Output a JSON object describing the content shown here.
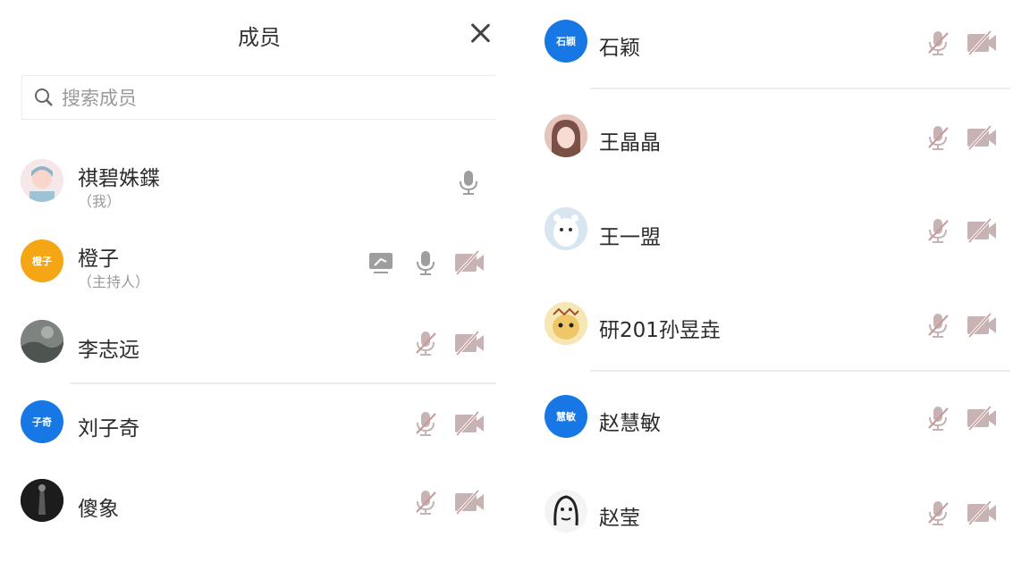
{
  "left_panel": {
    "title": "成员",
    "search_placeholder": "搜索成员",
    "members": [
      {
        "name": "祺碧姝鍱",
        "role": "（我）",
        "avatar_kind": "photo",
        "avatar_color": "#f3d9dc"
      },
      {
        "name": "橙子",
        "role": "（主持人）",
        "avatar_kind": "text",
        "avatar_text": "橙子",
        "avatar_color": "#f5a614"
      },
      {
        "name": "李志远",
        "role": "",
        "avatar_kind": "photo",
        "avatar_color": "#6e7570"
      },
      {
        "name": "刘子奇",
        "role": "",
        "avatar_kind": "text",
        "avatar_text": "子奇",
        "avatar_color": "#1677e5"
      },
      {
        "name": "傻象",
        "role": "",
        "avatar_kind": "photo",
        "avatar_color": "#1c1c1c"
      }
    ]
  },
  "right_panel": {
    "members": [
      {
        "name": "石颖",
        "avatar_kind": "text",
        "avatar_text": "石颖",
        "avatar_color": "#1677e5"
      },
      {
        "name": "王晶晶",
        "avatar_kind": "photo",
        "avatar_color": "#d9b0a6"
      },
      {
        "name": "王一盟",
        "avatar_kind": "photo",
        "avatar_color": "#c9dceb"
      },
      {
        "name": "研201孙昱垚",
        "avatar_kind": "photo",
        "avatar_color": "#f0c766"
      },
      {
        "name": "赵慧敏",
        "avatar_kind": "text",
        "avatar_text": "慧敏",
        "avatar_color": "#1677e5"
      },
      {
        "name": "赵莹",
        "avatar_kind": "photo",
        "avatar_color": "#f2f2f2"
      }
    ]
  },
  "colors": {
    "mic_active": "#9e9e9e",
    "icon_muted": "#c7b3b3",
    "muted_slash": "#c99898",
    "divider": "#ececec",
    "accent_blue": "#1677e5",
    "host_orange": "#f5a614"
  }
}
